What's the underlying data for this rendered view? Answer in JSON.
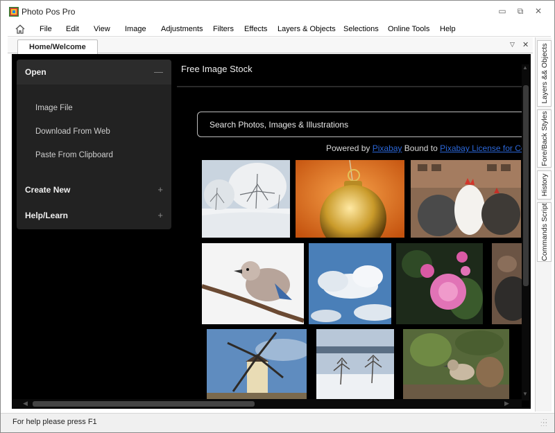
{
  "app": {
    "title": "Photo Pos Pro"
  },
  "window_controls": {
    "minimize": "▭",
    "maximize": "⧉",
    "close": "✕"
  },
  "menu": {
    "items": [
      "File",
      "Edit",
      "View",
      "Image",
      "Adjustments",
      "Filters",
      "Effects",
      "Layers & Objects",
      "Selections",
      "Online Tools",
      "Help"
    ]
  },
  "doc_tabs": {
    "active": "Home/Welcome",
    "pin": "▽",
    "close": "✕"
  },
  "left_panel": {
    "open": {
      "label": "Open",
      "sign": "—",
      "items": [
        "Image File",
        "Download From Web",
        "Paste From Clipboard"
      ]
    },
    "create_new": {
      "label": "Create New",
      "sign": "+"
    },
    "help_learn": {
      "label": "Help/Learn",
      "sign": "+"
    }
  },
  "stock": {
    "title": "Free Image Stock",
    "search_placeholder": "Search Photos, Images & Illustrations",
    "powered_prefix": "Powered by",
    "powered_link": "Pixabay",
    "bound_text": "Bound to",
    "license_link": "Pixabay License for Co"
  },
  "photos": [
    "snowy-trees",
    "gold-ornament",
    "roosters",
    "jay-bird",
    "clouds",
    "pink-flower",
    "hens",
    "windmill",
    "winter-trees",
    "sparrow-pinecone"
  ],
  "side_tabs": [
    "Layers && Objects",
    "Fore/Back Styles",
    "History",
    "Commands Script"
  ],
  "status": {
    "text": "For help please press F1"
  },
  "colors": {
    "panel": "#222222",
    "accent_link": "#2b67d9",
    "background": "#000000"
  }
}
